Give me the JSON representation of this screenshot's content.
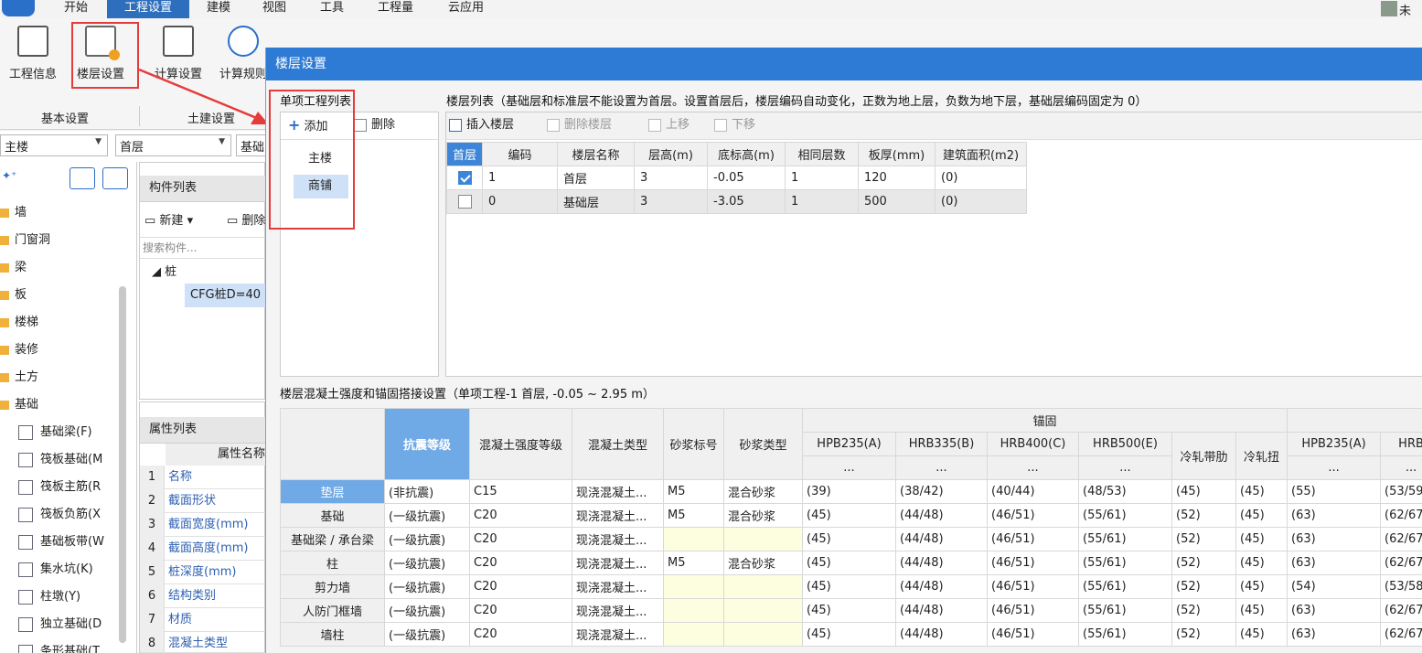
{
  "menubar": {
    "tabs": [
      "开始",
      "工程设置",
      "建模",
      "视图",
      "工具",
      "工程量",
      "云应用"
    ],
    "active_tab": "工程设置",
    "user": "未注"
  },
  "ribbon": {
    "buttons": [
      {
        "label": "工程信息",
        "icon": "doc-info-icon"
      },
      {
        "label": "楼层设置",
        "icon": "floor-settings-icon"
      },
      {
        "label": "计算设置",
        "icon": "calc-settings-icon"
      },
      {
        "label": "计算规则",
        "icon": "calc-rules-icon"
      }
    ],
    "groups": [
      "基本设置",
      "土建设置"
    ]
  },
  "left": {
    "project_combo": "主楼",
    "floor_combo": "首层",
    "type_combo": "基础",
    "tree": [
      "墙",
      "门窗洞",
      "梁",
      "板",
      "楼梯",
      "装修",
      "土方",
      "基础"
    ],
    "foundation_items": [
      "基础梁(F)",
      "筏板基础(M",
      "筏板主筋(R",
      "筏板负筋(X",
      "基础板带(W",
      "集水坑(K)",
      "柱墩(Y)",
      "独立基础(D",
      "条形基础(T"
    ],
    "component_list": {
      "title": "构件列表",
      "new_label": "新建",
      "delete_label": "删除",
      "search_placeholder": "搜索构件...",
      "group": "桩",
      "item": "CFG桩D=40"
    },
    "property_list": {
      "title": "属性列表",
      "header": "属性名称",
      "rows": [
        {
          "n": "1",
          "name": "名称"
        },
        {
          "n": "2",
          "name": "截面形状"
        },
        {
          "n": "3",
          "name": "截面宽度(mm)"
        },
        {
          "n": "4",
          "name": "截面高度(mm)"
        },
        {
          "n": "5",
          "name": "桩深度(mm)"
        },
        {
          "n": "6",
          "name": "结构类别"
        },
        {
          "n": "7",
          "name": "材质"
        },
        {
          "n": "8",
          "name": "混凝土类型"
        }
      ]
    }
  },
  "dialog": {
    "title": "楼层设置",
    "project_list_label": "单项工程列表",
    "add_label": "添加",
    "delete_label": "删除",
    "projects": [
      "主楼",
      "商铺"
    ],
    "selected_project": "商铺",
    "floor_list_label": "楼层列表（基础层和标准层不能设置为首层。设置首层后，楼层编码自动变化，正数为地上层，负数为地下层，基础层编码固定为 0）",
    "toolbar": {
      "insert": "插入楼层",
      "delete": "删除楼层",
      "up": "上移",
      "down": "下移"
    },
    "floor_headers": [
      "首层",
      "编码",
      "楼层名称",
      "层高(m)",
      "底标高(m)",
      "相同层数",
      "板厚(mm)",
      "建筑面积(m2)"
    ],
    "floors": [
      {
        "checked": true,
        "code": "1",
        "name": "首层",
        "height": "3",
        "bottom": "-0.05",
        "same": "1",
        "slab": "120",
        "area": "(0)"
      },
      {
        "checked": false,
        "code": "0",
        "name": "基础层",
        "height": "3",
        "bottom": "-3.05",
        "same": "1",
        "slab": "500",
        "area": "(0)"
      }
    ],
    "concrete_label": "楼层混凝土强度和锚固搭接设置（单项工程-1  首层, -0.05 ~ 2.95 m）",
    "anchor_group": "锚固",
    "concrete_headers": [
      "抗震等级",
      "混凝土强度等级",
      "混凝土类型",
      "砂浆标号",
      "砂浆类型",
      "HPB235(A)",
      "HRB335(B)",
      "HRB400(C)",
      "HRB500(E)",
      "冷轧带肋",
      "冷轧扭",
      "HPB235(A)",
      "HRB"
    ],
    "header_ellipsis": "...",
    "concrete_rows": [
      {
        "name": "垫层",
        "cells": [
          "(非抗震)",
          "C15",
          "现浇混凝土...",
          "M5",
          "混合砂浆",
          "(39)",
          "(38/42)",
          "(40/44)",
          "(48/53)",
          "(45)",
          "(45)",
          "(55)",
          "(53/59"
        ]
      },
      {
        "name": "基础",
        "cells": [
          "(一级抗震)",
          "C20",
          "现浇混凝土...",
          "M5",
          "混合砂浆",
          "(45)",
          "(44/48)",
          "(46/51)",
          "(55/61)",
          "(52)",
          "(45)",
          "(63)",
          "(62/67"
        ]
      },
      {
        "name": "基础梁 / 承台梁",
        "cells": [
          "(一级抗震)",
          "C20",
          "现浇混凝土...",
          "",
          "",
          "(45)",
          "(44/48)",
          "(46/51)",
          "(55/61)",
          "(52)",
          "(45)",
          "(63)",
          "(62/67"
        ]
      },
      {
        "name": "柱",
        "cells": [
          "(一级抗震)",
          "C20",
          "现浇混凝土...",
          "M5",
          "混合砂浆",
          "(45)",
          "(44/48)",
          "(46/51)",
          "(55/61)",
          "(52)",
          "(45)",
          "(63)",
          "(62/67"
        ]
      },
      {
        "name": "剪力墙",
        "cells": [
          "(一级抗震)",
          "C20",
          "现浇混凝土...",
          "",
          "",
          "(45)",
          "(44/48)",
          "(46/51)",
          "(55/61)",
          "(52)",
          "(45)",
          "(54)",
          "(53/58"
        ]
      },
      {
        "name": "人防门框墙",
        "cells": [
          "(一级抗震)",
          "C20",
          "现浇混凝土...",
          "",
          "",
          "(45)",
          "(44/48)",
          "(46/51)",
          "(55/61)",
          "(52)",
          "(45)",
          "(63)",
          "(62/67"
        ]
      },
      {
        "name": "墙柱",
        "cells": [
          "(一级抗震)",
          "C20",
          "现浇混凝土...",
          "",
          "",
          "(45)",
          "(44/48)",
          "(46/51)",
          "(55/61)",
          "(52)",
          "(45)",
          "(63)",
          "(62/67"
        ]
      }
    ]
  },
  "colors": {
    "accent": "#2d7bd4",
    "highlight": "#e63b3b"
  }
}
